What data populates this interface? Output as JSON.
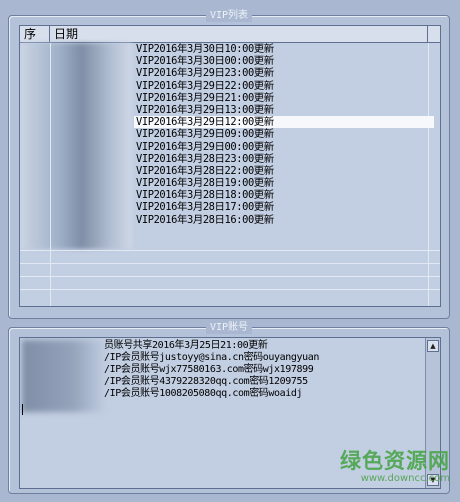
{
  "vip_list": {
    "title": "VIP列表",
    "columns": {
      "seq": "序",
      "date": "日期"
    },
    "rows": [
      "VIP2016年3月30日10:00更新",
      "VIP2016年3月30日00:00更新",
      "VIP2016年3月29日23:00更新",
      "VIP2016年3月29日22:00更新",
      "VIP2016年3月29日21:00更新",
      "VIP2016年3月29日13:00更新",
      "VIP2016年3月29日12:00更新",
      "VIP2016年3月29日09:00更新",
      "VIP2016年3月29日00:00更新",
      "VIP2016年3月28日23:00更新",
      "VIP2016年3月28日22:00更新",
      "VIP2016年3月28日19:00更新",
      "VIP2016年3月28日18:00更新",
      "VIP2016年3月28日17:00更新",
      "VIP2016年3月28日16:00更新"
    ],
    "selected_index": 6
  },
  "vip_account": {
    "title": "VIP账号",
    "lines": [
      "员账号共享2016年3月25日21:00更新",
      "/IP会员账号justoyy@sina.cn密码ouyangyuan",
      "/IP会员账号wjx77580163.com密码wjx197899",
      "/IP会员账号4379228320qq.com密码1209755",
      "/IP会员账号1008205080qq.com密码woaidj"
    ]
  },
  "watermark": {
    "main": "绿色资源网",
    "sub": "www.downcc.com"
  },
  "colors": {
    "background": "#a9b8d0",
    "panel": "#c2cee2",
    "watermark": "#4aa64a"
  }
}
